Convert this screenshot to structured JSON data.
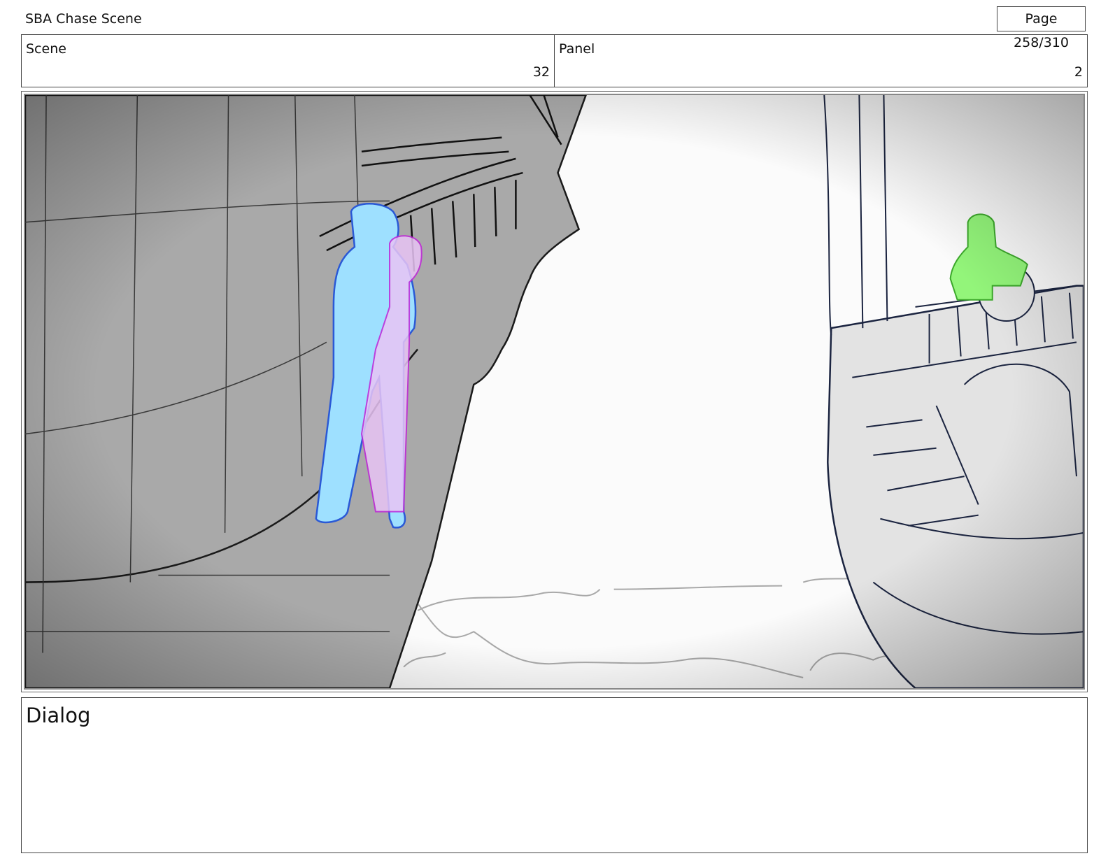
{
  "header": {
    "title": "SBA Chase Scene",
    "page": "Page 258/310"
  },
  "info": {
    "scene_label": "Scene",
    "scene_value": "32",
    "panel_label": "Panel",
    "panel_value": "2"
  },
  "dialog": {
    "label": "Dialog"
  },
  "colors": {
    "character_blue": "#9ee0ff",
    "character_pink": "#e8c4f5",
    "character_green": "#93f57a",
    "hull_gray": "#a9a9a9",
    "ship_light_gray": "#e3e3e3"
  }
}
